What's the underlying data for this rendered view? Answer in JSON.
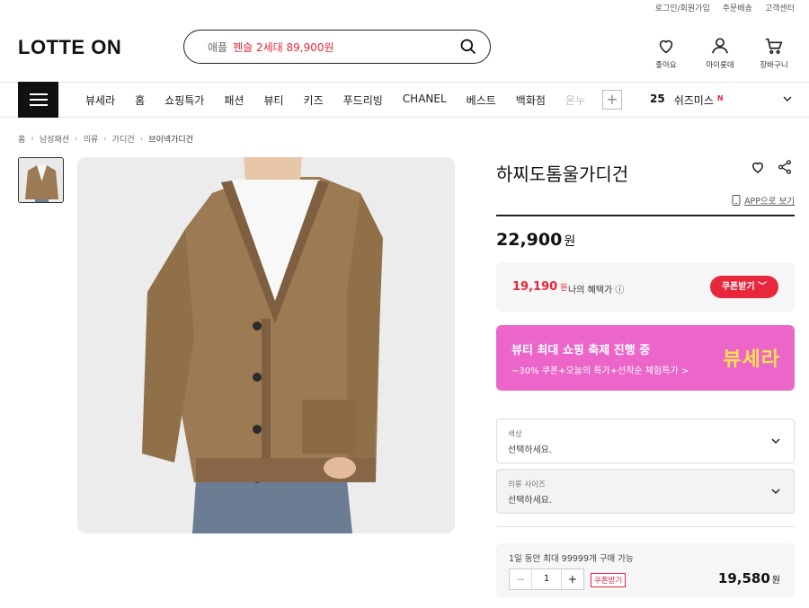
{
  "util_links": [
    "로그인/회원가입",
    "주문배송",
    "고객센터"
  ],
  "logo": "LOTTE ON",
  "search": {
    "placeholder_prefix": "애플",
    "placeholder_highlight": "펜슬 2세대 89,900원"
  },
  "header_icons": {
    "wishlist": "좋아요",
    "mypage": "마이롯데",
    "cart": "장바구니"
  },
  "gnb": {
    "items": [
      "뷰세라",
      "홈",
      "쇼핑특가",
      "패션",
      "뷰티",
      "키즈",
      "푸드리빙",
      "CHANEL",
      "베스트",
      "백화점",
      "온누"
    ],
    "plus": "+",
    "rank_number": "25",
    "rank_keyword": "쉬즈미스",
    "rank_badge": "N"
  },
  "breadcrumb": [
    "홈",
    "남성패션",
    "의류",
    "가디건",
    "브이넥가디건"
  ],
  "product": {
    "title": "하찌도톰울가디건",
    "app_view": "APP으로 보기",
    "price": "22,900",
    "won": "원",
    "benefit_price": "19,190",
    "benefit_won": "원",
    "benefit_label": "나의 혜택가",
    "coupon_button": "쿠폰받기"
  },
  "banner": {
    "title": "뷰티 최대 쇼핑 축제 진행 중",
    "subtitle": "~30% 쿠폰+오늘의 특가+선착순 체험특가 >",
    "brand": "뷰세라",
    "bg": "#ec65c8"
  },
  "options": [
    {
      "label": "색상",
      "value": "선택하세요."
    },
    {
      "label": "의류 사이즈",
      "value": "선택하세요."
    }
  ],
  "quantity": {
    "limit_text": "1일 동안 최대 99999개 구매 가능",
    "value": "1",
    "minus": "−",
    "plus": "+",
    "coupon": "쿠폰받기",
    "total": "19,580",
    "won": "원"
  },
  "colors": {
    "accent": "#e8263c",
    "cardigan": "#9b7a54"
  }
}
